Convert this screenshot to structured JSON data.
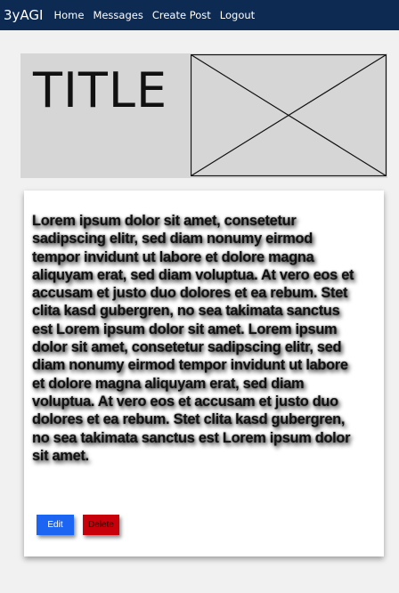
{
  "navbar": {
    "brand": "3yAGI",
    "links": [
      "Home",
      "Messages",
      "Create Post",
      "Logout"
    ]
  },
  "hero": {
    "title": "TITLE",
    "image_placeholder_icon": "image-placeholder-icon"
  },
  "post": {
    "body": "Lorem ipsum dolor sit amet, consetetur sadipscing elitr, sed diam nonumy eirmod tempor invidunt ut labore et dolore magna aliquyam erat, sed diam voluptua. At vero eos et accusam et justo duo dolores et ea rebum. Stet clita kasd gubergren, no sea takimata sanctus est Lorem ipsum dolor sit amet. Lorem ipsum dolor sit amet, consetetur sadipscing elitr, sed diam nonumy eirmod tempor invidunt ut labore et dolore magna aliquyam erat, sed diam voluptua. At vero eos et accusam et justo duo dolores et ea rebum. Stet clita kasd gubergren, no sea takimata sanctus est Lorem ipsum dolor sit amet.",
    "edit_label": "Edit",
    "delete_label": "Delete"
  },
  "colors": {
    "navbar": "#0c2a52",
    "edit_button": "#1c64f2",
    "delete_button": "#c8000a",
    "hero_background": "#d6d6d6"
  }
}
